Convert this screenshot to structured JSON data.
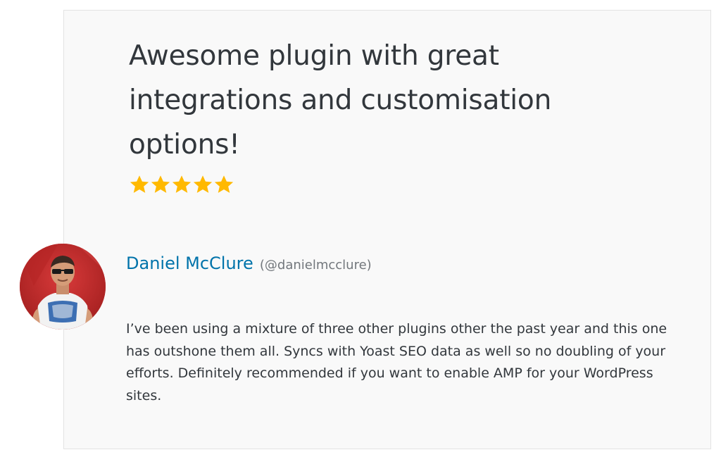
{
  "review": {
    "title": "Awesome plugin with great integrations and customisation options!",
    "rating": {
      "value": 5,
      "max": 5,
      "star_color": "#ffb900"
    },
    "author": {
      "name": "Daniel McClure",
      "handle": "(@danielmcclure)",
      "avatar_icon": "user-avatar-photo"
    },
    "body": "I’ve been using a mixture of three other plugins other the past year and this one has outshone them all. Syncs with Yoast SEO data as well so no doubling of your efforts. Definitely recommended if you want to enable AMP for your WordPress sites."
  },
  "colors": {
    "card_background": "#f9f9f9",
    "card_border": "#e3e3e3",
    "title": "#32373c",
    "link": "#0073aa",
    "muted": "#72777c"
  }
}
